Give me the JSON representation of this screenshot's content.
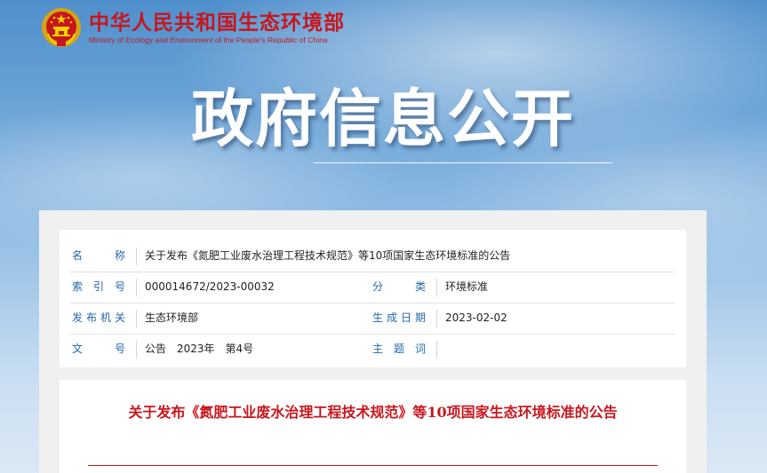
{
  "header": {
    "ministry_cn": "中华人民共和国生态环境部",
    "ministry_en": "Ministry of Ecology and Environment of the People's Republic of China",
    "emblem_icon": "national-emblem-icon",
    "brand_color": "#c8161d"
  },
  "hero": {
    "title": "政府信息公开"
  },
  "meta": {
    "name_label": "名　　称",
    "name_value": "关于发布《氮肥工业废水治理工程技术规范》等10项国家生态环境标准的公告",
    "index_label": "索 引 号",
    "index_value": "000014672/2023-00032",
    "category_label": "分　　类",
    "category_value": "环境标准",
    "issuer_label": "发布机关",
    "issuer_value": "生态环境部",
    "date_label": "生成日期",
    "date_value": "2023-02-02",
    "docno_label": "文　　号",
    "docno_value": "公告　2023年　第4号",
    "subject_label": "主 题 词",
    "subject_value": ""
  },
  "article": {
    "title": "关于发布《氮肥工业废水治理工程技术规范》等10项国家生态环境标准的公告"
  }
}
